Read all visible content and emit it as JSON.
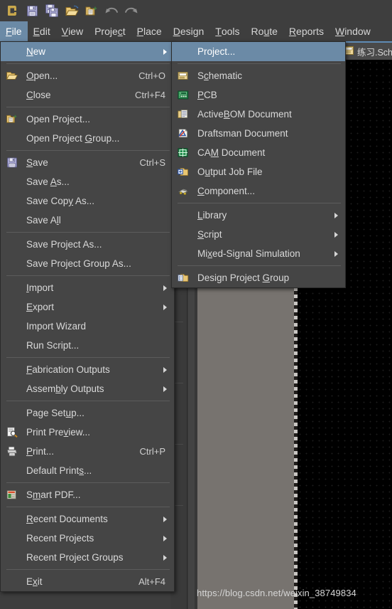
{
  "toolbar": {
    "buttons": [
      {
        "name": "altium-logo-icon",
        "label": "Altium"
      },
      {
        "name": "save-icon",
        "label": "Save"
      },
      {
        "name": "save-all-icon",
        "label": "Save All"
      },
      {
        "name": "open-folder-icon",
        "label": "Open"
      },
      {
        "name": "open-project-icon",
        "label": "Open Project"
      },
      {
        "name": "undo-icon",
        "label": "Undo"
      },
      {
        "name": "redo-icon",
        "label": "Redo"
      }
    ]
  },
  "menubar": {
    "items": [
      {
        "label": "File",
        "mnemonic": "F",
        "active": true
      },
      {
        "label": "Edit",
        "mnemonic": "E",
        "active": false
      },
      {
        "label": "View",
        "mnemonic": "V",
        "active": false
      },
      {
        "label": "Project",
        "mnemonic": "c",
        "active": false
      },
      {
        "label": "Place",
        "mnemonic": "P",
        "active": false
      },
      {
        "label": "Design",
        "mnemonic": "D",
        "active": false
      },
      {
        "label": "Tools",
        "mnemonic": "T",
        "active": false
      },
      {
        "label": "Route",
        "mnemonic": "u",
        "active": false
      },
      {
        "label": "Reports",
        "mnemonic": "R",
        "active": false
      },
      {
        "label": "Window",
        "mnemonic": "W",
        "active": false
      }
    ]
  },
  "document_tab": {
    "title": "练习.Sch",
    "icon": "schematic-icon"
  },
  "file_menu": {
    "items": [
      {
        "label": "New",
        "accel": "",
        "icon": "",
        "submenu": true,
        "highlighted": true,
        "type": "item"
      },
      {
        "type": "sep"
      },
      {
        "label": "Open...",
        "accel": "Ctrl+O",
        "icon": "open-folder-icon",
        "submenu": false,
        "highlighted": false,
        "type": "item"
      },
      {
        "label": "Close",
        "accel": "Ctrl+F4",
        "icon": "",
        "submenu": false,
        "highlighted": false,
        "type": "item"
      },
      {
        "type": "sep"
      },
      {
        "label": "Open Project...",
        "accel": "",
        "icon": "open-project-icon",
        "submenu": false,
        "highlighted": false,
        "type": "item"
      },
      {
        "label": "Open Project Group...",
        "accel": "",
        "icon": "",
        "submenu": false,
        "highlighted": false,
        "type": "item"
      },
      {
        "type": "sep"
      },
      {
        "label": "Save",
        "accel": "Ctrl+S",
        "icon": "save-icon",
        "submenu": false,
        "highlighted": false,
        "type": "item"
      },
      {
        "label": "Save As...",
        "accel": "",
        "icon": "",
        "submenu": false,
        "highlighted": false,
        "type": "item"
      },
      {
        "label": "Save Copy As...",
        "accel": "",
        "icon": "",
        "submenu": false,
        "highlighted": false,
        "type": "item"
      },
      {
        "label": "Save All",
        "accel": "",
        "icon": "",
        "submenu": false,
        "highlighted": false,
        "type": "item"
      },
      {
        "type": "sep"
      },
      {
        "label": "Save Project As...",
        "accel": "",
        "icon": "",
        "submenu": false,
        "highlighted": false,
        "type": "item"
      },
      {
        "label": "Save Project Group As...",
        "accel": "",
        "icon": "",
        "submenu": false,
        "highlighted": false,
        "type": "item"
      },
      {
        "type": "sep"
      },
      {
        "label": "Import",
        "accel": "",
        "icon": "",
        "submenu": true,
        "highlighted": false,
        "type": "item"
      },
      {
        "label": "Export",
        "accel": "",
        "icon": "",
        "submenu": true,
        "highlighted": false,
        "type": "item"
      },
      {
        "label": "Import Wizard",
        "accel": "",
        "icon": "",
        "submenu": false,
        "highlighted": false,
        "type": "item"
      },
      {
        "label": "Run Script...",
        "accel": "",
        "icon": "",
        "submenu": false,
        "highlighted": false,
        "type": "item"
      },
      {
        "type": "sep"
      },
      {
        "label": "Fabrication Outputs",
        "accel": "",
        "icon": "",
        "submenu": true,
        "highlighted": false,
        "type": "item"
      },
      {
        "label": "Assembly Outputs",
        "accel": "",
        "icon": "",
        "submenu": true,
        "highlighted": false,
        "type": "item"
      },
      {
        "type": "sep"
      },
      {
        "label": "Page Setup...",
        "accel": "",
        "icon": "",
        "submenu": false,
        "highlighted": false,
        "type": "item"
      },
      {
        "label": "Print Preview...",
        "accel": "",
        "icon": "print-preview-icon",
        "submenu": false,
        "highlighted": false,
        "type": "item"
      },
      {
        "label": "Print...",
        "accel": "Ctrl+P",
        "icon": "printer-icon",
        "submenu": false,
        "highlighted": false,
        "type": "item"
      },
      {
        "label": "Default Prints...",
        "accel": "",
        "icon": "",
        "submenu": false,
        "highlighted": false,
        "type": "item"
      },
      {
        "type": "sep"
      },
      {
        "label": "Smart PDF...",
        "accel": "",
        "icon": "pdf-icon",
        "submenu": false,
        "highlighted": false,
        "type": "item"
      },
      {
        "type": "sep"
      },
      {
        "label": "Recent Documents",
        "accel": "",
        "icon": "",
        "submenu": true,
        "highlighted": false,
        "type": "item"
      },
      {
        "label": "Recent Projects",
        "accel": "",
        "icon": "",
        "submenu": true,
        "highlighted": false,
        "type": "item"
      },
      {
        "label": "Recent Project Groups",
        "accel": "",
        "icon": "",
        "submenu": true,
        "highlighted": false,
        "type": "item"
      },
      {
        "type": "sep"
      },
      {
        "label": "Exit",
        "accel": "Alt+F4",
        "icon": "",
        "submenu": false,
        "highlighted": false,
        "type": "item"
      }
    ]
  },
  "new_submenu": {
    "items": [
      {
        "label": "Project...",
        "icon": "",
        "submenu": false,
        "highlighted": true,
        "type": "item"
      },
      {
        "type": "sep"
      },
      {
        "label": "Schematic",
        "icon": "schematic-icon",
        "submenu": false,
        "highlighted": false,
        "type": "item"
      },
      {
        "label": "PCB",
        "icon": "pcb-icon",
        "submenu": false,
        "highlighted": false,
        "type": "item"
      },
      {
        "label": "ActiveBOM Document",
        "icon": "activebom-icon",
        "submenu": false,
        "highlighted": false,
        "type": "item"
      },
      {
        "label": "Draftsman Document",
        "icon": "draftsman-icon",
        "submenu": false,
        "highlighted": false,
        "type": "item"
      },
      {
        "label": "CAM Document",
        "icon": "cam-icon",
        "submenu": false,
        "highlighted": false,
        "type": "item"
      },
      {
        "label": "Output Job File",
        "icon": "outputjob-icon",
        "submenu": false,
        "highlighted": false,
        "type": "item"
      },
      {
        "label": "Component...",
        "icon": "component-icon",
        "submenu": false,
        "highlighted": false,
        "type": "item"
      },
      {
        "type": "sep"
      },
      {
        "label": "Library",
        "icon": "",
        "submenu": true,
        "highlighted": false,
        "type": "item"
      },
      {
        "label": "Script",
        "icon": "",
        "submenu": true,
        "highlighted": false,
        "type": "item"
      },
      {
        "label": "Mixed-Signal Simulation",
        "icon": "",
        "submenu": true,
        "highlighted": false,
        "type": "item"
      },
      {
        "type": "sep"
      },
      {
        "label": "Design Project Group",
        "icon": "design-project-icon",
        "submenu": false,
        "highlighted": false,
        "type": "item"
      }
    ]
  },
  "watermark": {
    "text": "https://blog.csdn.net/weixin_38749834"
  },
  "colors": {
    "menu_bg": "#454545",
    "chrome_bg": "#3e3e3e",
    "highlight": "#6b8aa6",
    "text": "#d9d9d9",
    "canvas": "#000000",
    "sheet": "#77736f",
    "tab_accent": "#5f8bb5"
  }
}
